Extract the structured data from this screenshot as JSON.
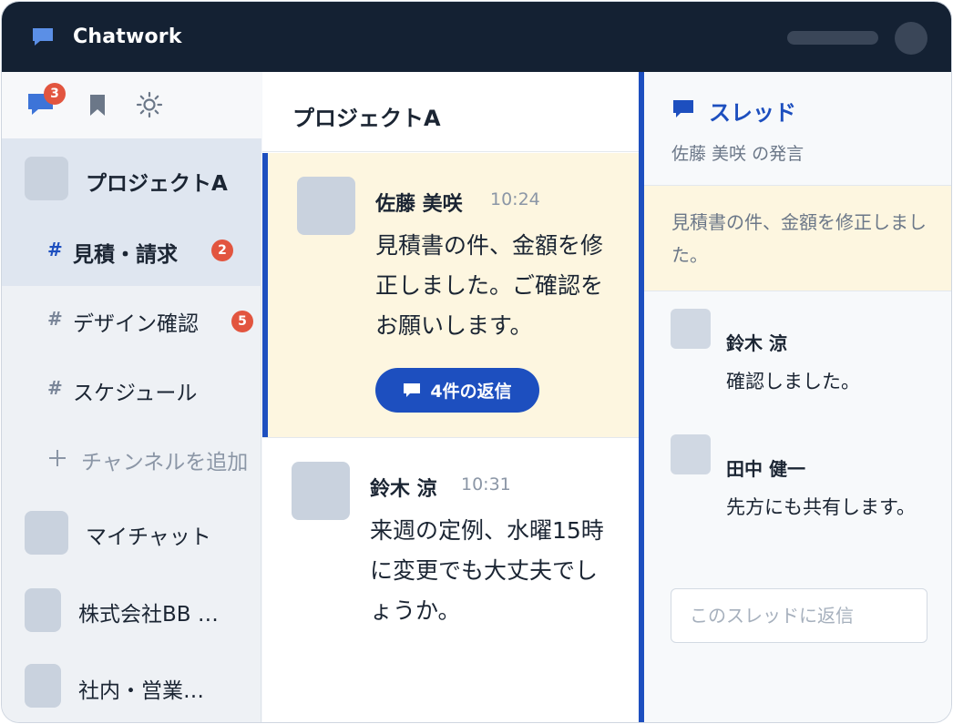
{
  "app": {
    "title": "Chatwork",
    "colors": {
      "topbar": "#142133",
      "accent": "#1d4fbf",
      "badge": "#e2553f",
      "highlight": "#fdf6e0"
    }
  },
  "sidebar": {
    "tools": [
      {
        "icon": "chat-icon",
        "badge": "3"
      },
      {
        "icon": "bookmark-icon"
      },
      {
        "icon": "settings-icon"
      }
    ],
    "active_room": "プロジェクトA",
    "channels": [
      {
        "label": "見積・請求",
        "badge": "2",
        "active": true
      },
      {
        "label": "デザイン確認",
        "badge": "5",
        "active": false
      },
      {
        "label": "スケジュール",
        "badge": "",
        "active": false
      }
    ],
    "add_channel_label": "チャンネルを追加",
    "rooms": [
      {
        "label": "マイチャット"
      },
      {
        "label": "株式会社BB …"
      },
      {
        "label": "社内・営業…"
      }
    ]
  },
  "chat": {
    "title": "プロジェクトA",
    "messages": [
      {
        "author": "佐藤 美咲",
        "time": "10:24",
        "text": "見積書の件、金額を修正しました。ご確認をお願いします。",
        "reply_button": "4件の返信",
        "highlighted": true
      },
      {
        "author": "鈴木 涼",
        "time": "10:31",
        "text": "来週の定例、水曜15時に変更でも大丈夫でしょうか。"
      }
    ]
  },
  "thread": {
    "title": "スレッド",
    "subtitle": "佐藤 美咲 の発言",
    "quote": "見積書の件、金額を修正しました。",
    "replies": [
      {
        "author": "鈴木 涼",
        "text": "確認しました。"
      },
      {
        "author": "田中 健一",
        "text": "先方にも共有します。"
      }
    ],
    "input_placeholder": "このスレッドに返信"
  }
}
